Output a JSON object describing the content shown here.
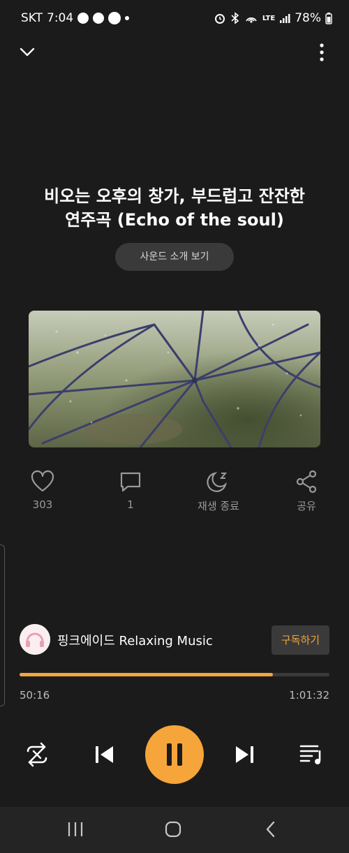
{
  "status_bar": {
    "carrier": "SKT",
    "time": "7:04",
    "network": "LTE",
    "battery": "78%"
  },
  "track": {
    "title_line1": "비오는 오후의 창가, 부드럽고 잔잔한",
    "title_line2": "연주곡 (Echo of the soul)",
    "sound_intro_button": "사운드 소개 보기"
  },
  "actions": {
    "like_count": "303",
    "comment_count": "1",
    "sleep_timer_label": "재생 종료",
    "share_label": "공유"
  },
  "channel": {
    "name": "핑크에이드 Relaxing Music",
    "subscribe_label": "구독하기"
  },
  "playback": {
    "elapsed": "50:16",
    "duration": "1:01:32",
    "progress_fraction": 0.817,
    "state": "playing"
  },
  "colors": {
    "accent": "#f5a53a",
    "background": "#1b1b1b"
  },
  "icons": [
    "chevron-down-icon",
    "more-vert-icon",
    "heart-icon",
    "comment-icon",
    "moon-sleep-icon",
    "share-icon",
    "repeat-icon",
    "skip-previous-icon",
    "pause-icon",
    "skip-next-icon",
    "playlist-icon"
  ]
}
